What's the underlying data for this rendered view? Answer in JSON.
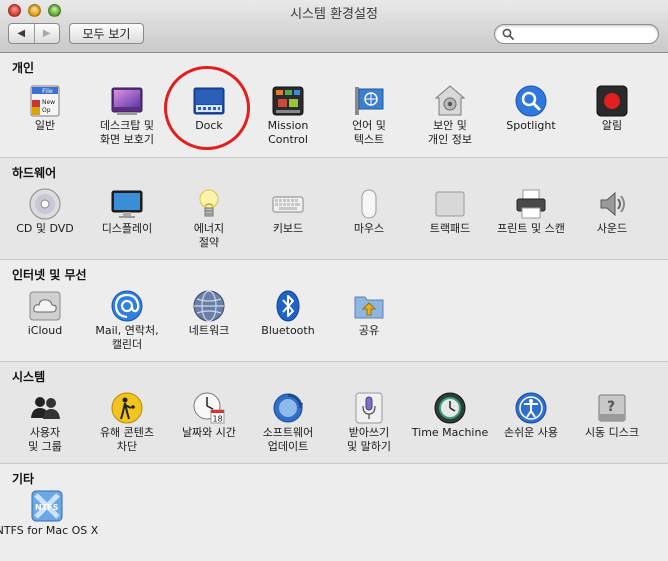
{
  "window": {
    "title": "시스템 환경설정"
  },
  "toolbar": {
    "back_label": "◀",
    "forward_label": "▶",
    "show_all_label": "모두 보기",
    "search_placeholder": ""
  },
  "colors": {
    "highlight_ring": "#e0201f",
    "dock_blue": "#2a5fb8",
    "mail_blue": "#2f7fe0"
  },
  "sections": [
    {
      "title": "개인",
      "items": [
        {
          "label": "일반",
          "icon": "general-icon"
        },
        {
          "label": "데스크탑 및\n화면 보호기",
          "icon": "desktop-screensaver-icon"
        },
        {
          "label": "Dock",
          "icon": "dock-icon"
        },
        {
          "label": "Mission\nControl",
          "icon": "mission-control-icon"
        },
        {
          "label": "언어 및\n텍스트",
          "icon": "language-text-icon"
        },
        {
          "label": "보안 및\n개인 정보",
          "icon": "security-privacy-icon"
        },
        {
          "label": "Spotlight",
          "icon": "spotlight-icon"
        },
        {
          "label": "알림",
          "icon": "notifications-icon"
        }
      ]
    },
    {
      "title": "하드웨어",
      "items": [
        {
          "label": "CD 및 DVD",
          "icon": "cd-dvd-icon"
        },
        {
          "label": "디스플레이",
          "icon": "display-icon"
        },
        {
          "label": "에너지\n절약",
          "icon": "energy-saver-icon"
        },
        {
          "label": "키보드",
          "icon": "keyboard-icon"
        },
        {
          "label": "마우스",
          "icon": "mouse-icon"
        },
        {
          "label": "트랙패드",
          "icon": "trackpad-icon"
        },
        {
          "label": "프린트 및 스캔",
          "icon": "print-scan-icon"
        },
        {
          "label": "사운드",
          "icon": "sound-icon"
        }
      ]
    },
    {
      "title": "인터넷 및 무선",
      "items": [
        {
          "label": "iCloud",
          "icon": "icloud-icon"
        },
        {
          "label": "Mail, 연락처,\n캘린더",
          "icon": "mail-contacts-icon"
        },
        {
          "label": "네트워크",
          "icon": "network-icon"
        },
        {
          "label": "Bluetooth",
          "icon": "bluetooth-icon"
        },
        {
          "label": "공유",
          "icon": "sharing-icon"
        }
      ]
    },
    {
      "title": "시스템",
      "items": [
        {
          "label": "사용자\n및 그룹",
          "icon": "users-groups-icon"
        },
        {
          "label": "유해 콘텐츠\n차단",
          "icon": "parental-controls-icon"
        },
        {
          "label": "날짜와 시간",
          "icon": "date-time-icon"
        },
        {
          "label": "소프트웨어\n업데이트",
          "icon": "software-update-icon"
        },
        {
          "label": "받아쓰기\n및 말하기",
          "icon": "dictation-speech-icon"
        },
        {
          "label": "Time Machine",
          "icon": "time-machine-icon"
        },
        {
          "label": "손쉬운 사용",
          "icon": "accessibility-icon"
        },
        {
          "label": "시동 디스크",
          "icon": "startup-disk-icon"
        }
      ]
    },
    {
      "title": "기타",
      "items": [
        {
          "label": "NTFS for Mac OS X",
          "icon": "ntfs-icon"
        }
      ]
    }
  ],
  "icon_text": {
    "general_file": "File",
    "general_new": "New",
    "general_open": "Op",
    "date_day": "18",
    "ntfs": "NTFS"
  }
}
